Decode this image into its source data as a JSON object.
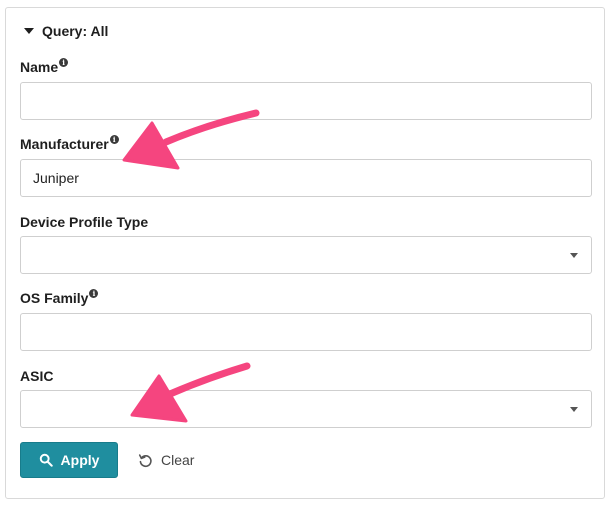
{
  "query": {
    "title": "Query: All"
  },
  "fields": {
    "name": {
      "label": "Name",
      "value": ""
    },
    "manufacturer": {
      "label": "Manufacturer",
      "value": "Juniper"
    },
    "device_profile_type": {
      "label": "Device Profile Type",
      "value": ""
    },
    "os_family": {
      "label": "OS Family",
      "value": ""
    },
    "asic": {
      "label": "ASIC",
      "value": ""
    }
  },
  "actions": {
    "apply_label": "Apply",
    "clear_label": "Clear"
  },
  "icons": {
    "info": "info-icon",
    "caret": "caret-down-icon",
    "select_arrow": "chevron-down-icon",
    "search": "search-icon",
    "clear": "undo-icon"
  },
  "colors": {
    "primary": "#1f8e9f",
    "annotation_arrow": "#f5457f",
    "border": "#cfcfcf"
  }
}
